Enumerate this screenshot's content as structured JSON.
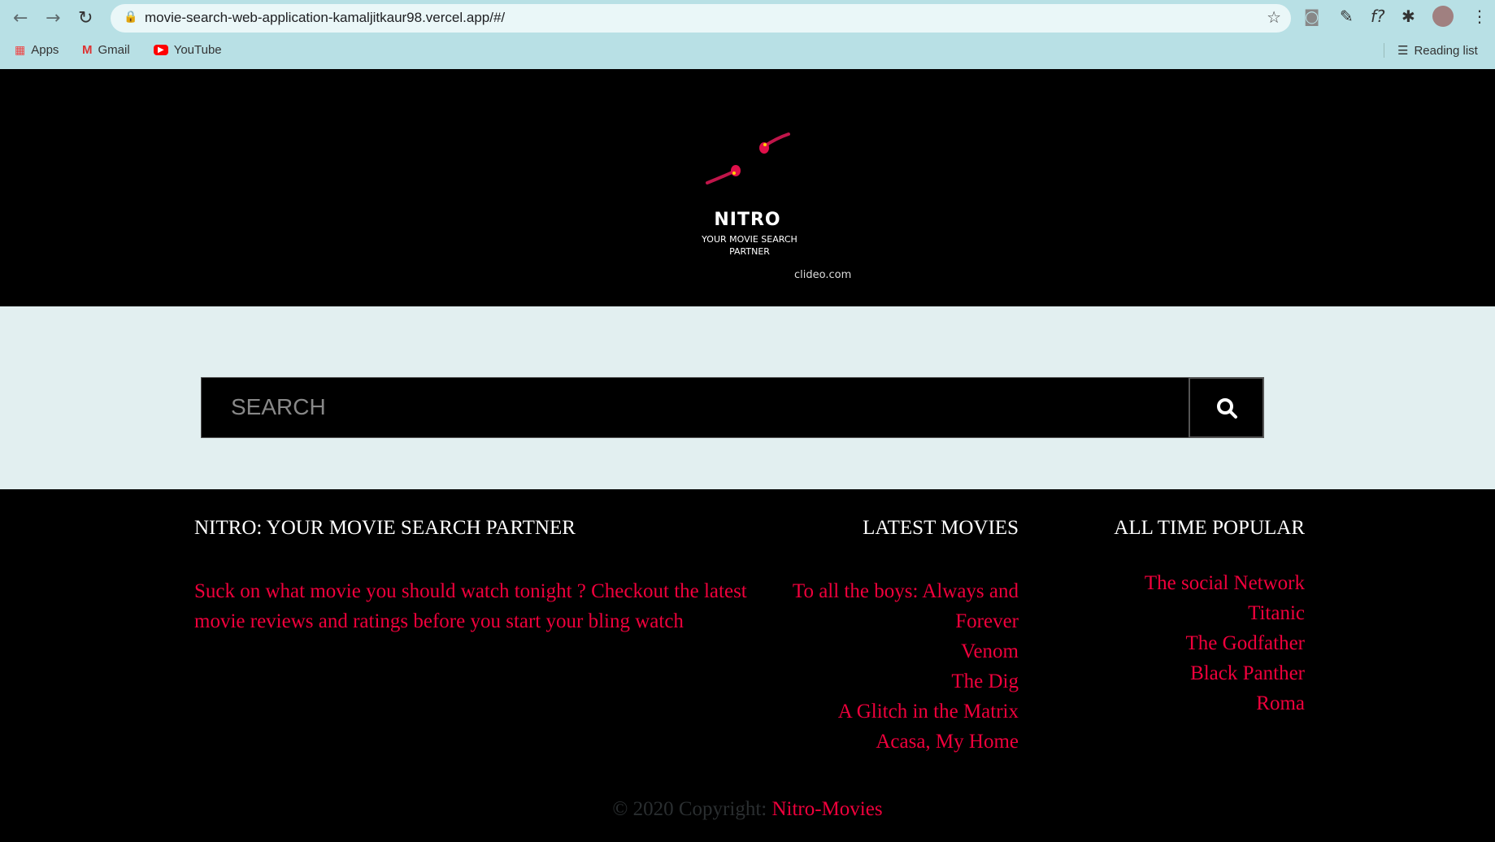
{
  "browser": {
    "url": "movie-search-web-application-kamaljitkaur98.vercel.app/#/",
    "bookmarks": [
      "Apps",
      "Gmail",
      "YouTube"
    ],
    "reading_list": "Reading list"
  },
  "header": {
    "title": "NITRO",
    "subtitle": "YOUR MOVIE SEARCH PARTNER",
    "watermark": "clideo.com"
  },
  "search": {
    "placeholder": "SEARCH"
  },
  "footer": {
    "about": {
      "heading": "NITRO: YOUR MOVIE SEARCH PARTNER",
      "text": "Suck on what movie you should watch tonight ? Checkout the latest movie reviews and ratings before you start your bling watch"
    },
    "latest": {
      "heading": "LATEST MOVIES",
      "items": [
        "To all the boys: Always and Forever",
        "Venom",
        "The Dig",
        "A Glitch in the Matrix",
        "Acasa, My Home"
      ]
    },
    "popular": {
      "heading": "ALL TIME POPULAR",
      "items": [
        "The social Network",
        "Titanic",
        "The Godfather",
        "Black Panther",
        "Roma"
      ]
    },
    "copyright": "© 2020 Copyright:",
    "brand_link": "Nitro-Movies"
  },
  "colors": {
    "accent": "#f0003c"
  }
}
